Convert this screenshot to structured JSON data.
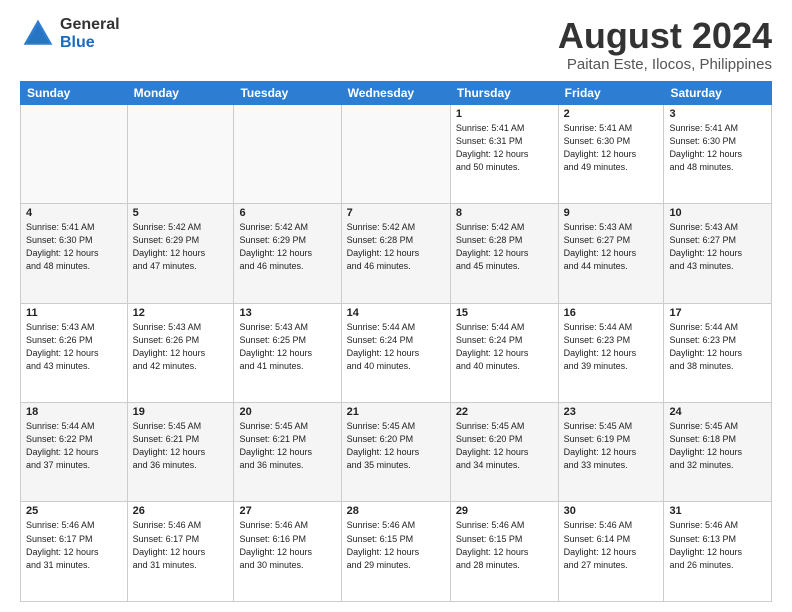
{
  "logo": {
    "general": "General",
    "blue": "Blue"
  },
  "title": "August 2024",
  "subtitle": "Paitan Este, Ilocos, Philippines",
  "days_header": [
    "Sunday",
    "Monday",
    "Tuesday",
    "Wednesday",
    "Thursday",
    "Friday",
    "Saturday"
  ],
  "weeks": [
    [
      {
        "num": "",
        "info": ""
      },
      {
        "num": "",
        "info": ""
      },
      {
        "num": "",
        "info": ""
      },
      {
        "num": "",
        "info": ""
      },
      {
        "num": "1",
        "info": "Sunrise: 5:41 AM\nSunset: 6:31 PM\nDaylight: 12 hours\nand 50 minutes."
      },
      {
        "num": "2",
        "info": "Sunrise: 5:41 AM\nSunset: 6:30 PM\nDaylight: 12 hours\nand 49 minutes."
      },
      {
        "num": "3",
        "info": "Sunrise: 5:41 AM\nSunset: 6:30 PM\nDaylight: 12 hours\nand 48 minutes."
      }
    ],
    [
      {
        "num": "4",
        "info": "Sunrise: 5:41 AM\nSunset: 6:30 PM\nDaylight: 12 hours\nand 48 minutes."
      },
      {
        "num": "5",
        "info": "Sunrise: 5:42 AM\nSunset: 6:29 PM\nDaylight: 12 hours\nand 47 minutes."
      },
      {
        "num": "6",
        "info": "Sunrise: 5:42 AM\nSunset: 6:29 PM\nDaylight: 12 hours\nand 46 minutes."
      },
      {
        "num": "7",
        "info": "Sunrise: 5:42 AM\nSunset: 6:28 PM\nDaylight: 12 hours\nand 46 minutes."
      },
      {
        "num": "8",
        "info": "Sunrise: 5:42 AM\nSunset: 6:28 PM\nDaylight: 12 hours\nand 45 minutes."
      },
      {
        "num": "9",
        "info": "Sunrise: 5:43 AM\nSunset: 6:27 PM\nDaylight: 12 hours\nand 44 minutes."
      },
      {
        "num": "10",
        "info": "Sunrise: 5:43 AM\nSunset: 6:27 PM\nDaylight: 12 hours\nand 43 minutes."
      }
    ],
    [
      {
        "num": "11",
        "info": "Sunrise: 5:43 AM\nSunset: 6:26 PM\nDaylight: 12 hours\nand 43 minutes."
      },
      {
        "num": "12",
        "info": "Sunrise: 5:43 AM\nSunset: 6:26 PM\nDaylight: 12 hours\nand 42 minutes."
      },
      {
        "num": "13",
        "info": "Sunrise: 5:43 AM\nSunset: 6:25 PM\nDaylight: 12 hours\nand 41 minutes."
      },
      {
        "num": "14",
        "info": "Sunrise: 5:44 AM\nSunset: 6:24 PM\nDaylight: 12 hours\nand 40 minutes."
      },
      {
        "num": "15",
        "info": "Sunrise: 5:44 AM\nSunset: 6:24 PM\nDaylight: 12 hours\nand 40 minutes."
      },
      {
        "num": "16",
        "info": "Sunrise: 5:44 AM\nSunset: 6:23 PM\nDaylight: 12 hours\nand 39 minutes."
      },
      {
        "num": "17",
        "info": "Sunrise: 5:44 AM\nSunset: 6:23 PM\nDaylight: 12 hours\nand 38 minutes."
      }
    ],
    [
      {
        "num": "18",
        "info": "Sunrise: 5:44 AM\nSunset: 6:22 PM\nDaylight: 12 hours\nand 37 minutes."
      },
      {
        "num": "19",
        "info": "Sunrise: 5:45 AM\nSunset: 6:21 PM\nDaylight: 12 hours\nand 36 minutes."
      },
      {
        "num": "20",
        "info": "Sunrise: 5:45 AM\nSunset: 6:21 PM\nDaylight: 12 hours\nand 36 minutes."
      },
      {
        "num": "21",
        "info": "Sunrise: 5:45 AM\nSunset: 6:20 PM\nDaylight: 12 hours\nand 35 minutes."
      },
      {
        "num": "22",
        "info": "Sunrise: 5:45 AM\nSunset: 6:20 PM\nDaylight: 12 hours\nand 34 minutes."
      },
      {
        "num": "23",
        "info": "Sunrise: 5:45 AM\nSunset: 6:19 PM\nDaylight: 12 hours\nand 33 minutes."
      },
      {
        "num": "24",
        "info": "Sunrise: 5:45 AM\nSunset: 6:18 PM\nDaylight: 12 hours\nand 32 minutes."
      }
    ],
    [
      {
        "num": "25",
        "info": "Sunrise: 5:46 AM\nSunset: 6:17 PM\nDaylight: 12 hours\nand 31 minutes."
      },
      {
        "num": "26",
        "info": "Sunrise: 5:46 AM\nSunset: 6:17 PM\nDaylight: 12 hours\nand 31 minutes."
      },
      {
        "num": "27",
        "info": "Sunrise: 5:46 AM\nSunset: 6:16 PM\nDaylight: 12 hours\nand 30 minutes."
      },
      {
        "num": "28",
        "info": "Sunrise: 5:46 AM\nSunset: 6:15 PM\nDaylight: 12 hours\nand 29 minutes."
      },
      {
        "num": "29",
        "info": "Sunrise: 5:46 AM\nSunset: 6:15 PM\nDaylight: 12 hours\nand 28 minutes."
      },
      {
        "num": "30",
        "info": "Sunrise: 5:46 AM\nSunset: 6:14 PM\nDaylight: 12 hours\nand 27 minutes."
      },
      {
        "num": "31",
        "info": "Sunrise: 5:46 AM\nSunset: 6:13 PM\nDaylight: 12 hours\nand 26 minutes."
      }
    ]
  ]
}
